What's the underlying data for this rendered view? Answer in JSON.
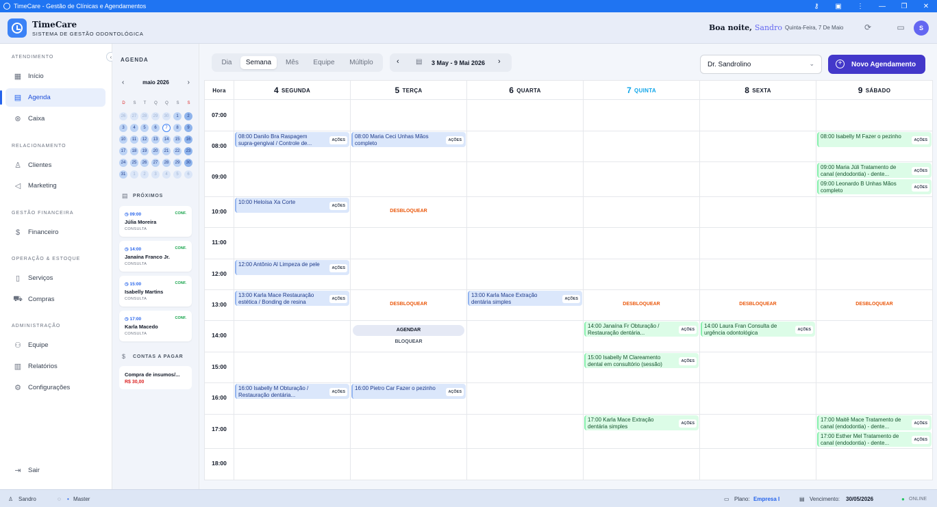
{
  "window": {
    "title": "TimeCare - Gestão de Clínicas e Agendamentos"
  },
  "brand": {
    "name": "TimeCare",
    "subtitle": "SISTEMA DE GESTÃO ODONTOLÓGICA"
  },
  "header": {
    "greeting": "Boa noite,",
    "user": "Sandro",
    "date": "Quinta-Feira, 7 De Maio",
    "avatar": "S"
  },
  "sidebar": {
    "sections": [
      "ATENDIMENTO",
      "RELACIONAMENTO",
      "GESTÃO FINANCEIRA",
      "OPERAÇÃO & ESTOQUE",
      "ADMINISTRAÇÃO"
    ],
    "items": [
      {
        "label": "Início",
        "icon": "dashboard-icon"
      },
      {
        "label": "Agenda",
        "icon": "calendar-icon",
        "active": true
      },
      {
        "label": "Caixa",
        "icon": "dollar-icon"
      },
      {
        "label": "Clientes",
        "icon": "users-icon"
      },
      {
        "label": "Marketing",
        "icon": "megaphone-icon"
      },
      {
        "label": "Financeiro",
        "icon": "dollar-sign-icon"
      },
      {
        "label": "Serviços",
        "icon": "clipboard-icon"
      },
      {
        "label": "Compras",
        "icon": "cart-icon"
      },
      {
        "label": "Equipe",
        "icon": "team-icon"
      },
      {
        "label": "Relatórios",
        "icon": "report-icon"
      },
      {
        "label": "Configurações",
        "icon": "gear-icon"
      }
    ],
    "logout": "Sair"
  },
  "agenda_panel": {
    "title": "AGENDA",
    "month": "maio 2026",
    "weekdays": [
      "D",
      "S",
      "T",
      "Q",
      "Q",
      "S",
      "S"
    ],
    "weeks": [
      [
        "26",
        "27",
        "28",
        "29",
        "30",
        "1",
        "2"
      ],
      [
        "3",
        "4",
        "5",
        "6",
        "7",
        "8",
        "9"
      ],
      [
        "10",
        "11",
        "12",
        "13",
        "14",
        "15",
        "16"
      ],
      [
        "17",
        "18",
        "19",
        "20",
        "21",
        "22",
        "23"
      ],
      [
        "24",
        "25",
        "26",
        "27",
        "28",
        "29",
        "30"
      ],
      [
        "31",
        "1",
        "2",
        "3",
        "4",
        "5",
        "6"
      ]
    ],
    "upcoming_title": "PRÓXIMOS",
    "upcoming": [
      {
        "time": "09:00",
        "status": "CONF.",
        "name": "Júlia Moreira",
        "type": "CONSULTA"
      },
      {
        "time": "14:00",
        "status": "CONF.",
        "name": "Janaína Franco Jr.",
        "type": "CONSULTA"
      },
      {
        "time": "15:00",
        "status": "CONF.",
        "name": "Isabelly Martins",
        "type": "CONSULTA"
      },
      {
        "time": "17:00",
        "status": "CONF.",
        "name": "Karla Macedo",
        "type": "CONSULTA"
      }
    ],
    "payables_title": "CONTAS A PAGAR",
    "payable": {
      "name": "Compra de insumos/...",
      "value": "R$ 30,00"
    }
  },
  "toolbar": {
    "views": [
      "Dia",
      "Semana",
      "Mês",
      "Equipe",
      "Múltiplo"
    ],
    "active_view": "Semana",
    "range": "3 May - 9 Mai 2026",
    "professional": "Dr. Sandrolino",
    "new_button": "Novo Agendamento"
  },
  "calendar": {
    "hour_label": "Hora",
    "days": [
      {
        "num": "4",
        "name": "SEGUNDA"
      },
      {
        "num": "5",
        "name": "TERÇA"
      },
      {
        "num": "6",
        "name": "QUARTA"
      },
      {
        "num": "7",
        "name": "QUINTA",
        "today": true
      },
      {
        "num": "8",
        "name": "SEXTA"
      },
      {
        "num": "9",
        "name": "SÁBADO"
      }
    ],
    "hours": [
      "07:00",
      "08:00",
      "09:00",
      "10:00",
      "11:00",
      "12:00",
      "13:00",
      "14:00",
      "15:00",
      "16:00",
      "17:00",
      "18:00"
    ],
    "actions_label": "AÇÕES",
    "unlock_label": "DESBLOQUEAR",
    "schedule_label": "AGENDAR",
    "block_label": "BLOQUEAR",
    "events": [
      {
        "day": 0,
        "slot": 1,
        "text": "08:00 Danilo Bra Raspagem supra-gengival / Controle de...",
        "color": "blue"
      },
      {
        "day": 1,
        "slot": 1,
        "text": "08:00 Maria Ceci Unhas Mãos completo",
        "color": "blue"
      },
      {
        "day": 5,
        "slot": 1,
        "text": "08:00 Isabelly M Fazer o pezinho",
        "color": "green"
      },
      {
        "day": 5,
        "slot": 2,
        "text": "09:00 Maria Júli Tratamento de canal (endodontia) - dente...",
        "color": "green"
      },
      {
        "day": 5,
        "slot": 2.5,
        "text": "09:00 Leonardo B Unhas Mãos completo",
        "color": "green"
      },
      {
        "day": 0,
        "slot": 3,
        "text": "10:00 Heloísa Xa Corte",
        "color": "blue"
      },
      {
        "day": 0,
        "slot": 5,
        "text": "12:00 Antônio Al Limpeza de pele",
        "color": "blue"
      },
      {
        "day": 0,
        "slot": 6,
        "text": "13:00 Karla Mace Restauração estética / Bonding de resina",
        "color": "blue"
      },
      {
        "day": 2,
        "slot": 6,
        "text": "13:00 Karla Mace Extração dentária simples",
        "color": "blue"
      },
      {
        "day": 3,
        "slot": 7,
        "text": "14:00 Janaína Fr Obturação / Restauração dentária...",
        "color": "green"
      },
      {
        "day": 4,
        "slot": 7,
        "text": "14:00 Laura Fran Consulta de urgência odontológica",
        "color": "green"
      },
      {
        "day": 3,
        "slot": 8,
        "text": "15:00 Isabelly M Clareamento dental em consultório (sessão)",
        "color": "green"
      },
      {
        "day": 0,
        "slot": 9,
        "text": "16:00 Isabelly M Obturação / Restauração dentária...",
        "color": "blue"
      },
      {
        "day": 1,
        "slot": 9,
        "text": "16:00 Pietro Car Fazer o pezinho",
        "color": "blue"
      },
      {
        "day": 3,
        "slot": 10,
        "text": "17:00 Karla Mace Extração dentária simples",
        "color": "green"
      },
      {
        "day": 5,
        "slot": 10,
        "text": "17:00 Maitê Mace Tratamento de canal (endodontia) - dente...",
        "color": "green"
      },
      {
        "day": 5,
        "slot": 10.5,
        "text": "17:00 Esther Mel Tratamento de canal (endodontia) - dente...",
        "color": "green"
      }
    ],
    "unlocks": [
      {
        "day": 1,
        "slot": 3
      },
      {
        "day": 1,
        "slot": 6
      },
      {
        "day": 3,
        "slot": 6
      },
      {
        "day": 4,
        "slot": 6
      },
      {
        "day": 5,
        "slot": 6
      }
    ]
  },
  "statusbar": {
    "user": "Sandro",
    "role": "Master",
    "plan_label": "Plano:",
    "plan": "Empresa I",
    "due_label": "Vencimento:",
    "due": "30/05/2026",
    "online": "ONLINE"
  },
  "colors": {
    "primary": "#2563eb",
    "accent": "#4338ca",
    "titlebar": "#1f74f2",
    "event_blue": "#dbe7fb",
    "event_green": "#dcfce7",
    "unlock": "#ea580c"
  }
}
